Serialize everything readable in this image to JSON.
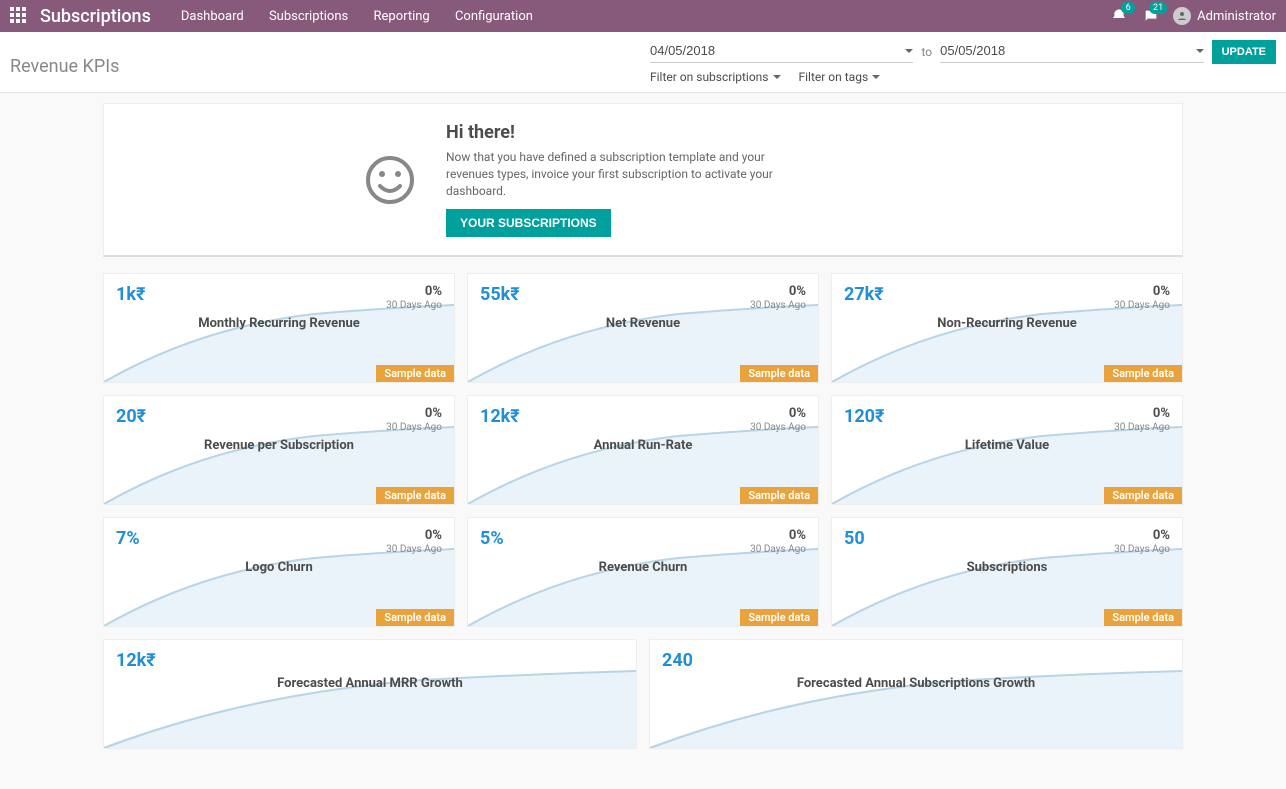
{
  "topbar": {
    "brand": "Subscriptions",
    "menu": [
      "Dashboard",
      "Subscriptions",
      "Reporting",
      "Configuration"
    ],
    "badges": {
      "activity": "6",
      "messages": "21"
    },
    "user": "Administrator"
  },
  "subbar": {
    "title": "Revenue KPIs",
    "date_from": "04/05/2018",
    "to_label": "to",
    "date_to": "05/05/2018",
    "update": "UPDATE",
    "filter_subs": "Filter on subscriptions",
    "filter_tags": "Filter on tags"
  },
  "banner": {
    "heading": "Hi there!",
    "text": "Now that you have defined a subscription template and your revenues types, invoice your first subscription to activate your dashboard.",
    "button": "YOUR SUBSCRIPTIONS"
  },
  "sample_label": "Sample data",
  "kpi": [
    {
      "value": "1k₹",
      "pct": "0%",
      "ago": "30 Days Ago",
      "title": "Monthly Recurring Revenue"
    },
    {
      "value": "55k₹",
      "pct": "0%",
      "ago": "30 Days Ago",
      "title": "Net Revenue"
    },
    {
      "value": "27k₹",
      "pct": "0%",
      "ago": "30 Days Ago",
      "title": "Non-Recurring Revenue"
    },
    {
      "value": "20₹",
      "pct": "0%",
      "ago": "30 Days Ago",
      "title": "Revenue per Subscription"
    },
    {
      "value": "12k₹",
      "pct": "0%",
      "ago": "30 Days Ago",
      "title": "Annual Run-Rate"
    },
    {
      "value": "120₹",
      "pct": "0%",
      "ago": "30 Days Ago",
      "title": "Lifetime Value"
    },
    {
      "value": "7%",
      "pct": "0%",
      "ago": "30 Days Ago",
      "title": "Logo Churn"
    },
    {
      "value": "5%",
      "pct": "0%",
      "ago": "30 Days Ago",
      "title": "Revenue Churn"
    },
    {
      "value": "50",
      "pct": "0%",
      "ago": "30 Days Ago",
      "title": "Subscriptions"
    }
  ],
  "kpi_wide": [
    {
      "value": "12k₹",
      "title": "Forecasted Annual MRR Growth"
    },
    {
      "value": "240",
      "title": "Forecasted Annual Subscriptions Growth"
    }
  ],
  "chart_data": {
    "type": "line",
    "note": "Decorative sparkline curve repeated on each KPI card (sample data).",
    "x": [
      0,
      0.2,
      0.4,
      0.6,
      0.8,
      1.0
    ],
    "y": [
      0,
      0.35,
      0.6,
      0.78,
      0.9,
      0.97
    ]
  }
}
